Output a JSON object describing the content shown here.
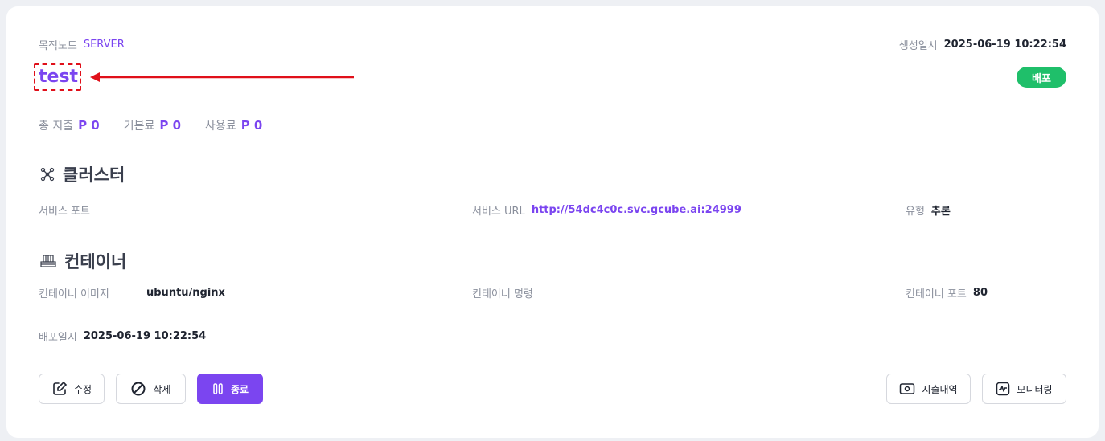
{
  "header": {
    "target_node_label": "목적노드",
    "target_node_value": "SERVER",
    "created_label": "생성일시",
    "created_value": "2025-06-19 10:22:54",
    "title": "test",
    "status": "배포"
  },
  "costs": [
    {
      "label": "총 지출",
      "value": "P 0"
    },
    {
      "label": "기본료",
      "value": "P 0"
    },
    {
      "label": "사용료",
      "value": "P 0"
    }
  ],
  "cluster": {
    "title": "클러스터",
    "service_port_label": "서비스 포트",
    "service_url_label": "서비스 URL",
    "service_url_value": "http://54dc4c0c.svc.gcube.ai:24999",
    "type_label": "유형",
    "type_value": "추론"
  },
  "container": {
    "title": "컨테이너",
    "image_label": "컨테이너 이미지",
    "image_value": "ubuntu/nginx",
    "command_label": "컨테이너 명령",
    "port_label": "컨테이너 포트",
    "port_value": "80",
    "deployed_label": "배포일시",
    "deployed_value": "2025-06-19 10:22:54"
  },
  "actions": {
    "edit": "수정",
    "delete": "삭제",
    "stop": "종료",
    "spending": "지출내역",
    "monitoring": "모니터링"
  },
  "colors": {
    "accent": "#7b45f0",
    "status_green": "#1fbf6a",
    "highlight_red": "#e0101a"
  }
}
